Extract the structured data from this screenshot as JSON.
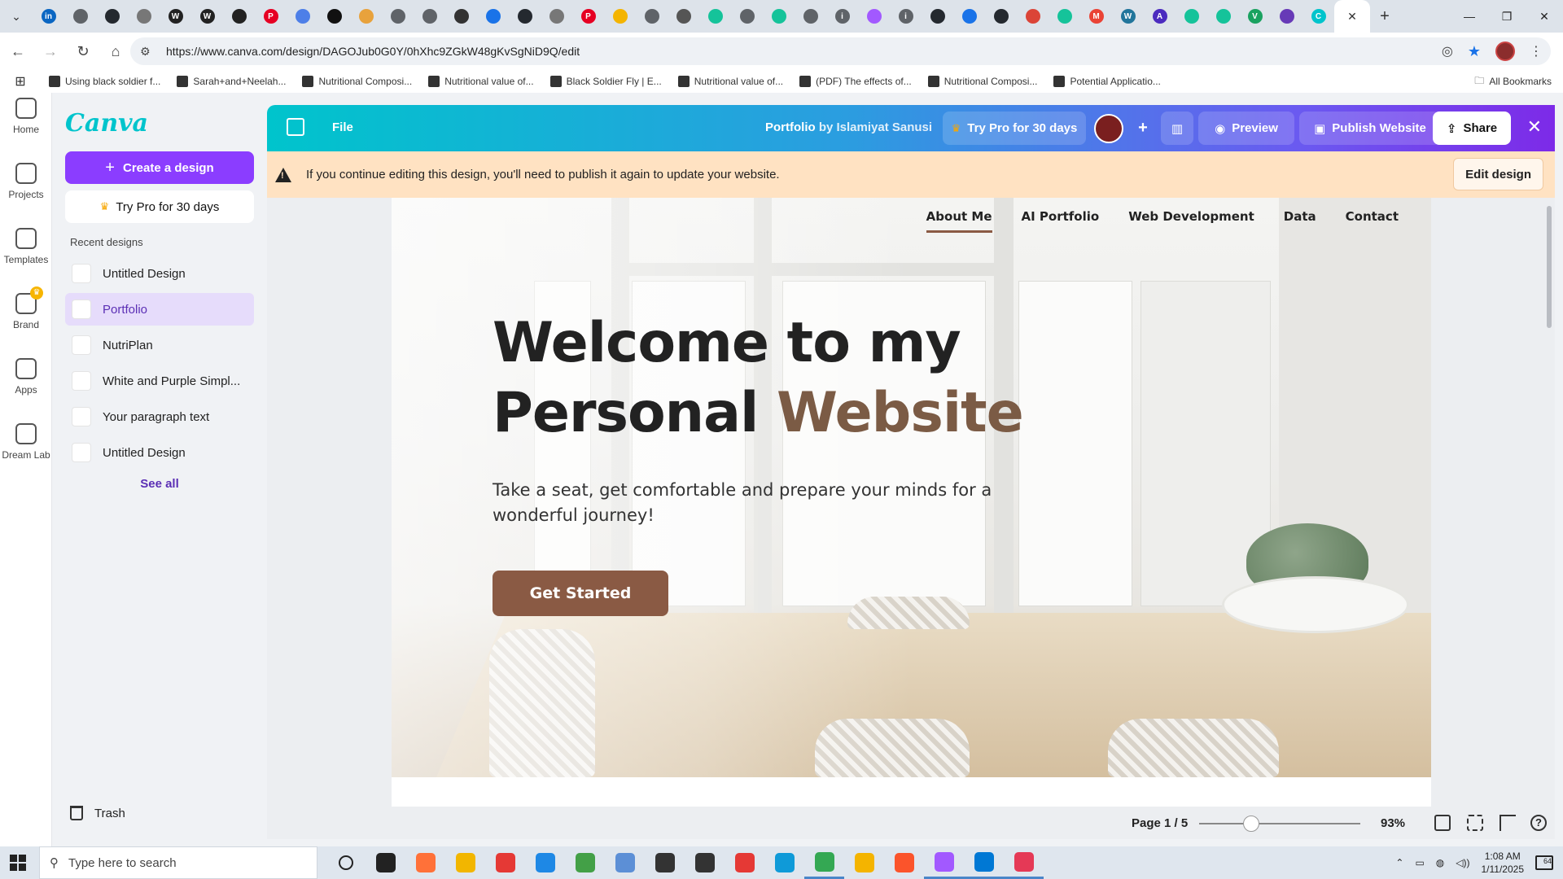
{
  "browser": {
    "tabs": [
      {
        "icon": "linkedin-icon",
        "color": "#0a66c2",
        "glyph": "in"
      },
      {
        "icon": "globe-icon",
        "color": "#5f6368",
        "glyph": ""
      },
      {
        "icon": "github-icon",
        "color": "#24292f",
        "glyph": ""
      },
      {
        "icon": "gear-icon",
        "color": "#777777",
        "glyph": ""
      },
      {
        "icon": "wordpress-icon",
        "color": "#222222",
        "glyph": "W"
      },
      {
        "icon": "wordpress-icon",
        "color": "#222222",
        "glyph": "W"
      },
      {
        "icon": "photo-icon",
        "color": "#222222",
        "glyph": ""
      },
      {
        "icon": "pinterest-icon",
        "color": "#e60023",
        "glyph": "P"
      },
      {
        "icon": "chat-icon",
        "color": "#4d7fe8",
        "glyph": ""
      },
      {
        "icon": "notion-icon",
        "color": "#111111",
        "glyph": ""
      },
      {
        "icon": "shield-icon",
        "color": "#e8a23c",
        "glyph": ""
      },
      {
        "icon": "globe-icon",
        "color": "#5f6368",
        "glyph": ""
      },
      {
        "icon": "globe-icon",
        "color": "#5f6368",
        "glyph": ""
      },
      {
        "icon": "openai-icon",
        "color": "#333333",
        "glyph": ""
      },
      {
        "icon": "pen-icon",
        "color": "#1a73e8",
        "glyph": ""
      },
      {
        "icon": "github-icon",
        "color": "#24292f",
        "glyph": ""
      },
      {
        "icon": "gear-icon",
        "color": "#777777",
        "glyph": ""
      },
      {
        "icon": "pinterest-icon",
        "color": "#e60023",
        "glyph": "P"
      },
      {
        "icon": "star-icon",
        "color": "#f4b400",
        "glyph": ""
      },
      {
        "icon": "globe-icon",
        "color": "#5f6368",
        "glyph": ""
      },
      {
        "icon": "dash-icon",
        "color": "#555555",
        "glyph": ""
      },
      {
        "icon": "grammarly-icon",
        "color": "#15c39a",
        "glyph": ""
      },
      {
        "icon": "globe-icon",
        "color": "#5f6368",
        "glyph": ""
      },
      {
        "icon": "grammarly-icon",
        "color": "#15c39a",
        "glyph": ""
      },
      {
        "icon": "globe-icon",
        "color": "#5f6368",
        "glyph": ""
      },
      {
        "icon": "info-icon",
        "color": "#5f6368",
        "glyph": "i"
      },
      {
        "icon": "figma-icon",
        "color": "#a259ff",
        "glyph": ""
      },
      {
        "icon": "info-icon",
        "color": "#5f6368",
        "glyph": "i"
      },
      {
        "icon": "github-icon",
        "color": "#24292f",
        "glyph": ""
      },
      {
        "icon": "document-icon",
        "color": "#1a73e8",
        "glyph": ""
      },
      {
        "icon": "github-icon",
        "color": "#24292f",
        "glyph": ""
      },
      {
        "icon": "chrome-icon",
        "color": "#db4437",
        "glyph": ""
      },
      {
        "icon": "grammarly-icon",
        "color": "#15c39a",
        "glyph": ""
      },
      {
        "icon": "gmail-icon",
        "color": "#ea4335",
        "glyph": "M"
      },
      {
        "icon": "wordpress-icon",
        "color": "#21759b",
        "glyph": "W"
      },
      {
        "icon": "a-icon",
        "color": "#4b2bbf",
        "glyph": "A"
      },
      {
        "icon": "grammarly-icon",
        "color": "#15c39a",
        "glyph": ""
      },
      {
        "icon": "grammarly-icon",
        "color": "#15c39a",
        "glyph": ""
      },
      {
        "icon": "v-icon",
        "color": "#1aa260",
        "glyph": "V"
      },
      {
        "icon": "forms-icon",
        "color": "#673ab7",
        "glyph": ""
      },
      {
        "icon": "canva-icon",
        "color": "#00c4cc",
        "glyph": "C"
      }
    ],
    "url": "https://www.canva.com/design/DAGOJub0G0Y/0hXhc9ZGkW48gKvSgNiD9Q/edit",
    "bookmarks": [
      "Using black soldier f...",
      "Sarah+and+Neelah...",
      "Nutritional Composi...",
      "Nutritional value of...",
      "Black Soldier Fly | E...",
      "Nutritional value of...",
      "(PDF) The effects of...",
      "Nutritional Composi...",
      "Potential Applicatio..."
    ],
    "all_bookmarks": "All Bookmarks"
  },
  "rail": [
    {
      "label": "Home",
      "icon": "home-icon"
    },
    {
      "label": "Projects",
      "icon": "folder-icon"
    },
    {
      "label": "Templates",
      "icon": "templates-icon"
    },
    {
      "label": "Brand",
      "icon": "brand-icon"
    },
    {
      "label": "Apps",
      "icon": "apps-icon"
    },
    {
      "label": "Dream Lab",
      "icon": "dream-lab-icon"
    }
  ],
  "side": {
    "logo": "Canva",
    "create_label": "Create a design",
    "trypro_label": "Try Pro for 30 days",
    "recent_label": "Recent designs",
    "recent": [
      {
        "name": "Untitled Design",
        "active": false
      },
      {
        "name": "Portfolio",
        "active": true
      },
      {
        "name": "NutriPlan",
        "active": false
      },
      {
        "name": "White and Purple Simpl...",
        "active": false
      },
      {
        "name": "Your paragraph text",
        "active": false
      },
      {
        "name": "Untitled Design",
        "active": false
      }
    ],
    "see_all": "See all",
    "trash": "Trash"
  },
  "editor": {
    "file": "File",
    "title": "Portfolio",
    "by": "by Islamiyat Sanusi",
    "trypro": "Try Pro for 30 days",
    "preview": "Preview",
    "publish": "Publish Website",
    "share": "Share",
    "banner": "If you continue editing this design, you'll need to publish it again to update your website.",
    "edit_design": "Edit design",
    "page": "Page 1 / 5",
    "zoom": "93%",
    "zoom_level_percent": 93
  },
  "site": {
    "nav": [
      "About Me",
      "AI Portfolio",
      "Web Development",
      "Data",
      "Contact"
    ],
    "title_line1": "Welcome to my",
    "title_line2a": "Personal ",
    "title_line2b": "Website",
    "subtitle": "Take a seat, get comfortable and prepare your minds for a wonderful journey!",
    "cta": "Get Started"
  },
  "taskbar": {
    "search_placeholder": "Type here to search",
    "apps": [
      {
        "icon": "cortana-icon",
        "color": "#222222",
        "running": false
      },
      {
        "icon": "task-view-icon",
        "color": "#222222",
        "running": false
      },
      {
        "icon": "firefox-icon",
        "color": "#ff7139",
        "running": false
      },
      {
        "icon": "file-explorer-icon",
        "color": "#f2b600",
        "running": false
      },
      {
        "icon": "gift-icon",
        "color": "#e53935",
        "running": false
      },
      {
        "icon": "mail-icon",
        "color": "#1e88e5",
        "running": false
      },
      {
        "icon": "leaf-icon",
        "color": "#43a047",
        "running": false
      },
      {
        "icon": "globe-app-icon",
        "color": "#5c8fd6",
        "running": false
      },
      {
        "icon": "settings-icon",
        "color": "#333333",
        "running": false
      },
      {
        "icon": "f-app-icon",
        "color": "#333333",
        "running": false
      },
      {
        "icon": "opera-icon",
        "color": "#e53935",
        "running": false
      },
      {
        "icon": "edge-icon",
        "color": "#0f9ad8",
        "running": false
      },
      {
        "icon": "chrome-icon",
        "color": "#34a853",
        "running": true
      },
      {
        "icon": "chrome-canary-icon",
        "color": "#f4b400",
        "running": false
      },
      {
        "icon": "brave-icon",
        "color": "#fb542b",
        "running": false
      },
      {
        "icon": "figma-icon",
        "color": "#a259ff",
        "running": true
      },
      {
        "icon": "vscode-icon",
        "color": "#0078d4",
        "running": true
      },
      {
        "icon": "chat-app-icon",
        "color": "#e53956",
        "running": true
      }
    ],
    "notif_count": "64",
    "time": "1:08 AM",
    "date": "1/11/2025"
  }
}
